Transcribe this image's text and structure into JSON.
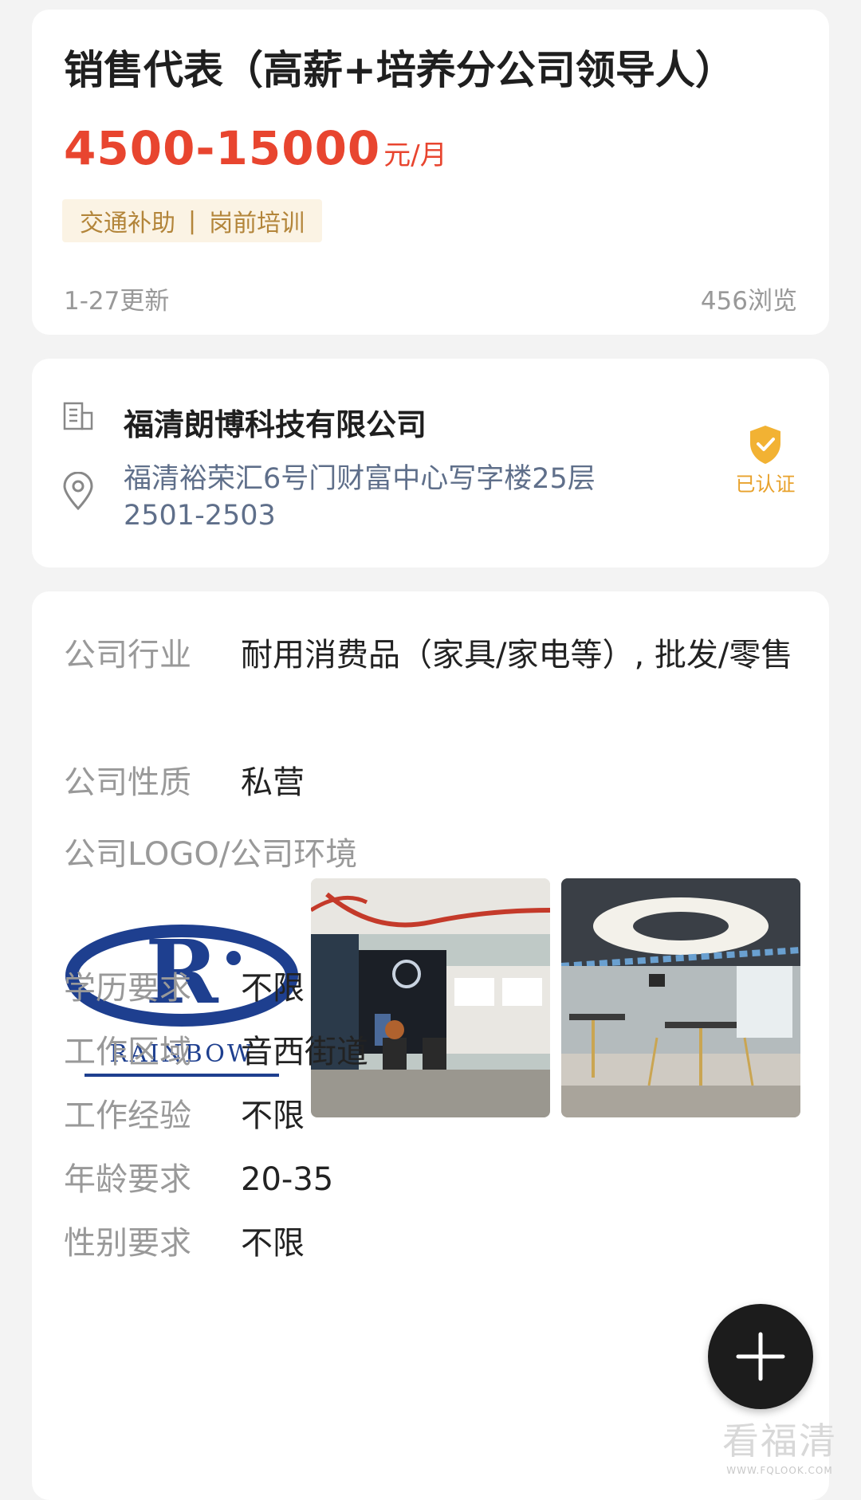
{
  "job": {
    "title": "销售代表（高薪+培养分公司领导人）",
    "salary_amount": "4500-15000",
    "salary_unit": "元/月",
    "tags": [
      "交通补助",
      "岗前培训"
    ],
    "tag_separator": "|",
    "updated": "1-27更新",
    "views": "456浏览"
  },
  "company": {
    "name": "福清朗博科技有限公司",
    "address": "福清裕荣汇6号门财富中心写字楼25层2501-2503",
    "verified_label": "已认证",
    "icons": {
      "building": "building-icon",
      "location": "location-pin-icon",
      "verified": "shield-check-icon"
    }
  },
  "details": {
    "industry_label": "公司行业",
    "industry_value": "耐用消费品（家具/家电等）, 批发/零售",
    "nature_label": "公司性质",
    "nature_value": "私营",
    "logo_label": "公司LOGO/公司环境",
    "logo_text": "RAINBOW",
    "rows": [
      {
        "label": "学历要求",
        "value": "不限"
      },
      {
        "label": "工作区域",
        "value": "音西街道"
      },
      {
        "label": "工作经验",
        "value": "不限"
      },
      {
        "label": "年龄要求",
        "value": "20-35"
      },
      {
        "label": "性别要求",
        "value": "不限"
      }
    ]
  },
  "fab": {
    "icon": "plus-icon"
  },
  "watermark": {
    "main": "看福清",
    "sub": "WWW.FQLOOK.COM"
  },
  "colors": {
    "salary": "#e8452f",
    "tag_bg": "#fbf3e4",
    "tag_text": "#b3853a",
    "verified": "#e8a22c",
    "address": "#5f6f8a"
  }
}
